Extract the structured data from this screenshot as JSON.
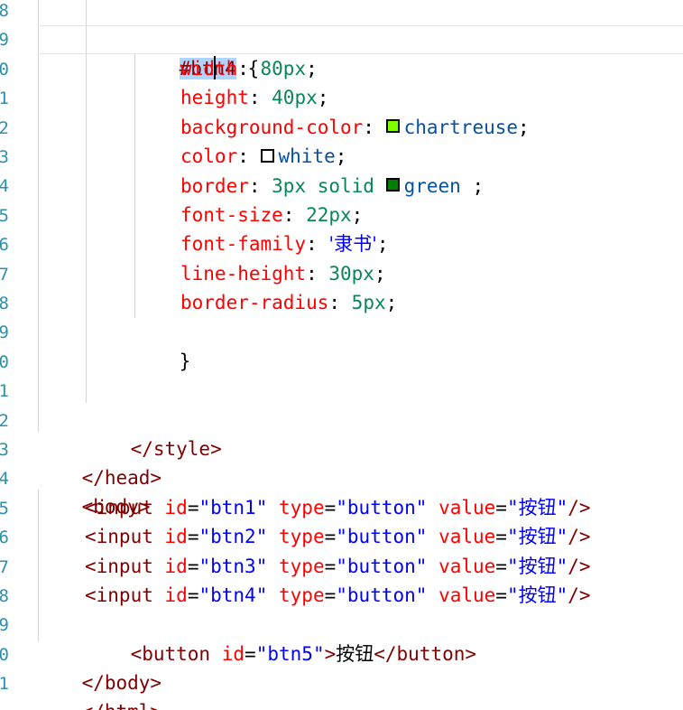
{
  "gutter": {
    "line_numbers": [
      "8",
      "9",
      "0",
      "1",
      "2",
      "3",
      "4",
      "5",
      "6",
      "7",
      "8",
      "9",
      "0",
      "1",
      "2",
      "3",
      "4",
      "5",
      "6",
      "7",
      "8",
      "9",
      "0",
      "1"
    ]
  },
  "css_rule": {
    "selector_part1": "#bt",
    "selector_part2": "n4",
    "open_brace": " {",
    "close_brace": "}",
    "declarations": [
      {
        "prop": "width",
        "colon": ": ",
        "value": "80px",
        "value_class": "num",
        "end": ";"
      },
      {
        "prop": "height",
        "colon": ": ",
        "value": "40px",
        "value_class": "num",
        "end": ";"
      },
      {
        "prop": "background-color",
        "colon": ": ",
        "swatch": "#7fff00",
        "value": "chartreuse",
        "value_class": "kw",
        "end": ";"
      },
      {
        "prop": "color",
        "colon": ": ",
        "swatch": "#ffffff",
        "value": "white",
        "value_class": "kw",
        "end": ";"
      },
      {
        "prop": "border",
        "colon": ": ",
        "pre_value": "3px solid ",
        "swatch": "#008000",
        "value": "green",
        "value_class": "kw",
        "end": " ;"
      },
      {
        "prop": "font-size",
        "colon": ": ",
        "value": "22px",
        "value_class": "num",
        "end": ";"
      },
      {
        "prop": "font-family",
        "colon": ": ",
        "value": "'隶书'",
        "value_class": "str",
        "end": ";"
      },
      {
        "prop": "line-height",
        "colon": ": ",
        "value": "30px",
        "value_class": "num",
        "end": ";"
      },
      {
        "prop": "border-radius",
        "colon": ": ",
        "value": "5px",
        "value_class": "num",
        "end": ";"
      }
    ]
  },
  "markup": {
    "style_close": "</style>",
    "head_close": "</head>",
    "body_open": "<body>",
    "inputs": [
      {
        "id": "btn1",
        "type": "button",
        "value": "按钮"
      },
      {
        "id": "btn2",
        "type": "button",
        "value": "按钮"
      },
      {
        "id": "btn3",
        "type": "button",
        "value": "按钮"
      },
      {
        "id": "btn4",
        "type": "button",
        "value": "按钮"
      }
    ],
    "button": {
      "id": "btn5",
      "text": "按钮"
    },
    "body_close": "</body>",
    "html_close": "</html>"
  },
  "colors": {
    "tag": "#800000",
    "attribute": "#ff0000",
    "string": "#0000ff",
    "number": "#098658",
    "keyword": "#0451a5",
    "selection": "#add6ff",
    "line_number": "#2b91af"
  }
}
